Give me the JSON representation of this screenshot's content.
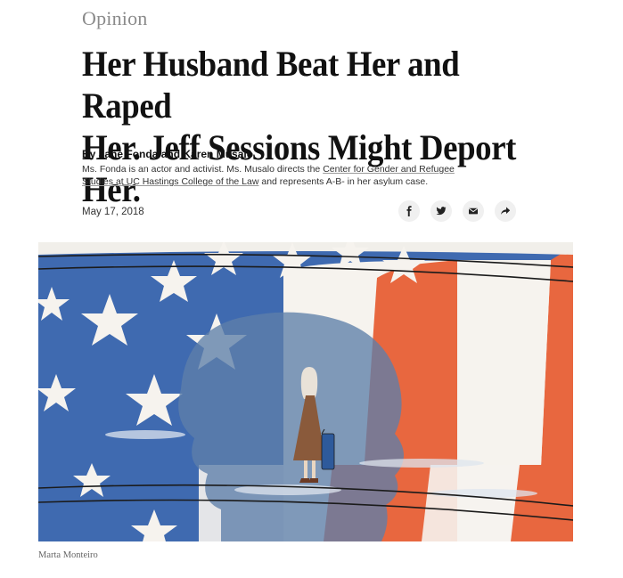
{
  "article": {
    "kicker": "Opinion",
    "headline_line1": "Her Husband Beat Her and Raped",
    "headline_line2": "Her. Jeff Sessions Might Deport Her.",
    "byline": "By Jane Fonda and Karen Musalo",
    "bio_prefix": "Ms. Fonda is an actor and activist. Ms. Musalo directs the ",
    "bio_link": "Center for Gender and Refugee Studies at UC Hastings College of the Law",
    "bio_suffix": " and represents A-B- in her asylum case.",
    "date": "May 17, 2018",
    "image_credit": "Marta Monteiro"
  },
  "share": {
    "icons": [
      "facebook-icon",
      "twitter-icon",
      "email-icon",
      "share-arrow-icon"
    ]
  },
  "colors": {
    "flag_blue": "#3f6ab0",
    "flag_red": "#e8673f",
    "flag_white": "#f6f3ee",
    "silhouette": "#6c87a8",
    "dress": "#8a5a3b"
  }
}
